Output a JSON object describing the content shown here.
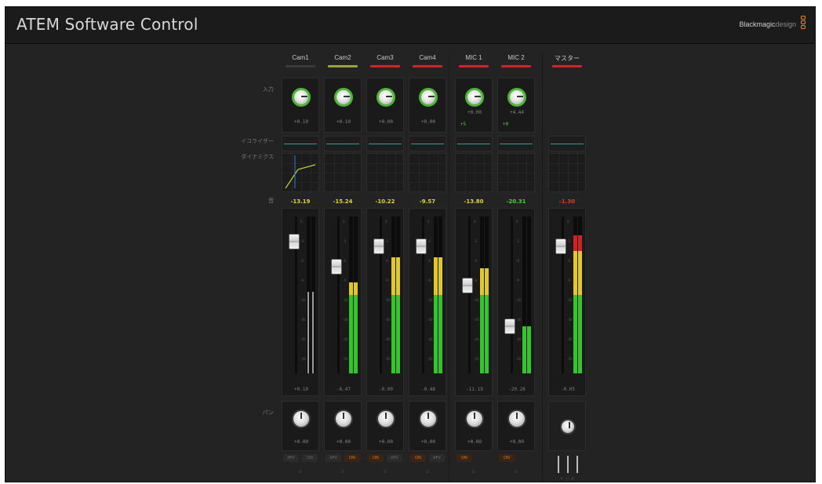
{
  "app": {
    "title": "ATEM Software Control",
    "brand_bold": "Blackmagic",
    "brand_light": "design"
  },
  "row_labels": {
    "input": "入力",
    "equalizer": "イコライザー",
    "dynamics": "ダイナミクス",
    "level": "音",
    "pan": "パン"
  },
  "channels": [
    {
      "name": "Cam1",
      "tally": "#3a3a3a",
      "gain": "+0.10",
      "db": "-13.19",
      "db_color": "#e3d53a",
      "fader": "+0.10",
      "pan": "+0.00",
      "afv": "AFV",
      "on": "ON",
      "active": "none"
    },
    {
      "name": "Cam2",
      "tally": "#9aa42a",
      "gain": "+0.10",
      "db": "-15.24",
      "db_color": "#e3d53a",
      "fader": "-6.47",
      "pan": "+0.00",
      "afv": "AFV",
      "on": "ON",
      "active": "afv"
    },
    {
      "name": "Cam3",
      "tally": "#e02020",
      "gain": "+0.00",
      "db": "-10.22",
      "db_color": "#e3d53a",
      "fader": "-0.00",
      "pan": "+0.00",
      "afv": "ON",
      "on": "AFV",
      "active": "on"
    },
    {
      "name": "Cam4",
      "tally": "#e02020",
      "gain": "+0.00",
      "db": "-9.57",
      "db_color": "#e3d53a",
      "fader": "-0.48",
      "pan": "+0.00",
      "afv": "ON",
      "on": "AFV",
      "active": "on"
    },
    {
      "name": "MIC 1",
      "tally": "#e02020",
      "gain": "+0.00",
      "db": "-13.80",
      "db_color": "#e3d53a",
      "fader": "-11.19",
      "pan": "+0.00",
      "afv": "ON",
      "on": "",
      "active": "on",
      "extra": "+5"
    },
    {
      "name": "MIC 2",
      "tally": "#e02020",
      "gain": "+4.44",
      "db": "-20.31",
      "db_color": "#4cd236",
      "fader": "-20.26",
      "pan": "+0.00",
      "afv": "ON",
      "on": "",
      "active": "on",
      "extra": "+0"
    },
    {
      "name": "マスター",
      "tally": "#e02020",
      "gain": "",
      "db": "-1.30",
      "db_color": "#e53a2a",
      "fader": "-0.05",
      "pan": "",
      "afv": "",
      "on": "",
      "active": "master"
    }
  ],
  "meters": [
    {
      "left_fill": 0.52,
      "right_fill": 0.52,
      "fader_pos": 0.16,
      "type": "grey"
    },
    {
      "left_fill": 0.58,
      "right_fill": 0.58,
      "fader_pos": 0.32,
      "type": "color"
    },
    {
      "left_fill": 0.74,
      "right_fill": 0.74,
      "fader_pos": 0.19,
      "type": "color"
    },
    {
      "left_fill": 0.74,
      "right_fill": 0.74,
      "fader_pos": 0.19,
      "type": "color"
    },
    {
      "left_fill": 0.67,
      "right_fill": 0.67,
      "fader_pos": 0.44,
      "type": "color"
    },
    {
      "left_fill": 0.3,
      "right_fill": 0.3,
      "fader_pos": 0.7,
      "type": "color"
    },
    {
      "left_fill": 0.88,
      "right_fill": 0.88,
      "fader_pos": 0.19,
      "type": "master"
    }
  ],
  "scale_labels": [
    "0",
    "-3",
    "-6",
    "-9",
    "-20",
    "-30",
    "-40",
    "-50"
  ],
  "colors": {
    "green": "#35c42a",
    "yellow": "#e0c82a",
    "red": "#d42020",
    "knob_ring": "#4cb832",
    "orange": "#e07a1c"
  }
}
